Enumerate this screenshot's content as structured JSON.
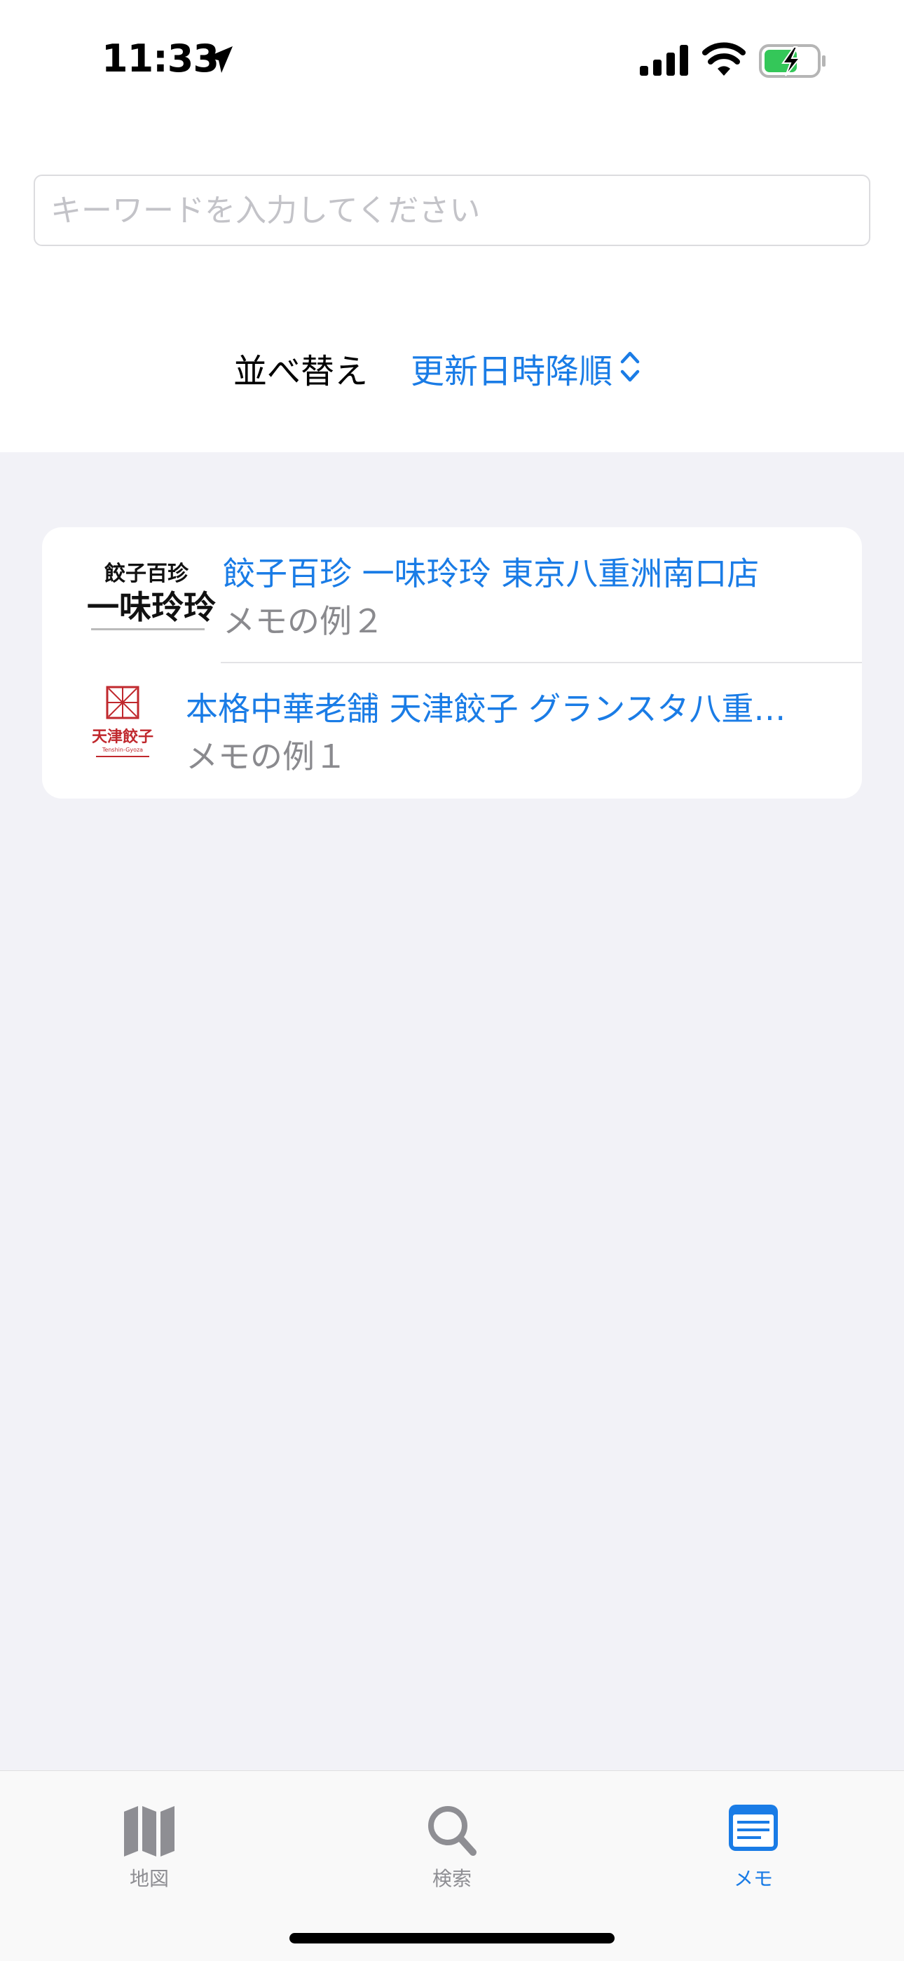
{
  "status_bar": {
    "time": "11:33"
  },
  "search": {
    "placeholder": "キーワードを入力してください",
    "value": ""
  },
  "sort": {
    "label": "並べ替え",
    "value": "更新日時降順"
  },
  "list": [
    {
      "title": "餃子百珍 一味玲玲 東京八重洲南口店",
      "memo": "メモの例２",
      "logo_text": [
        "餃子百珍",
        "一味玲玲"
      ]
    },
    {
      "title": "本格中華老舗 天津餃子 グランスタ八重…",
      "memo": "メモの例１",
      "logo_text": [
        "天津餃子",
        "Tenshin-Gyoza"
      ]
    }
  ],
  "tabs": [
    {
      "label": "地図",
      "icon": "map-icon",
      "active": false
    },
    {
      "label": "検索",
      "icon": "magnifier-icon",
      "active": false
    },
    {
      "label": "メモ",
      "icon": "memo-icon",
      "active": true
    }
  ],
  "colors": {
    "accent": "#1a7ce6",
    "inactive": "#8e8e93",
    "background": "#f2f2f7",
    "logo_red": "#c0282d"
  }
}
